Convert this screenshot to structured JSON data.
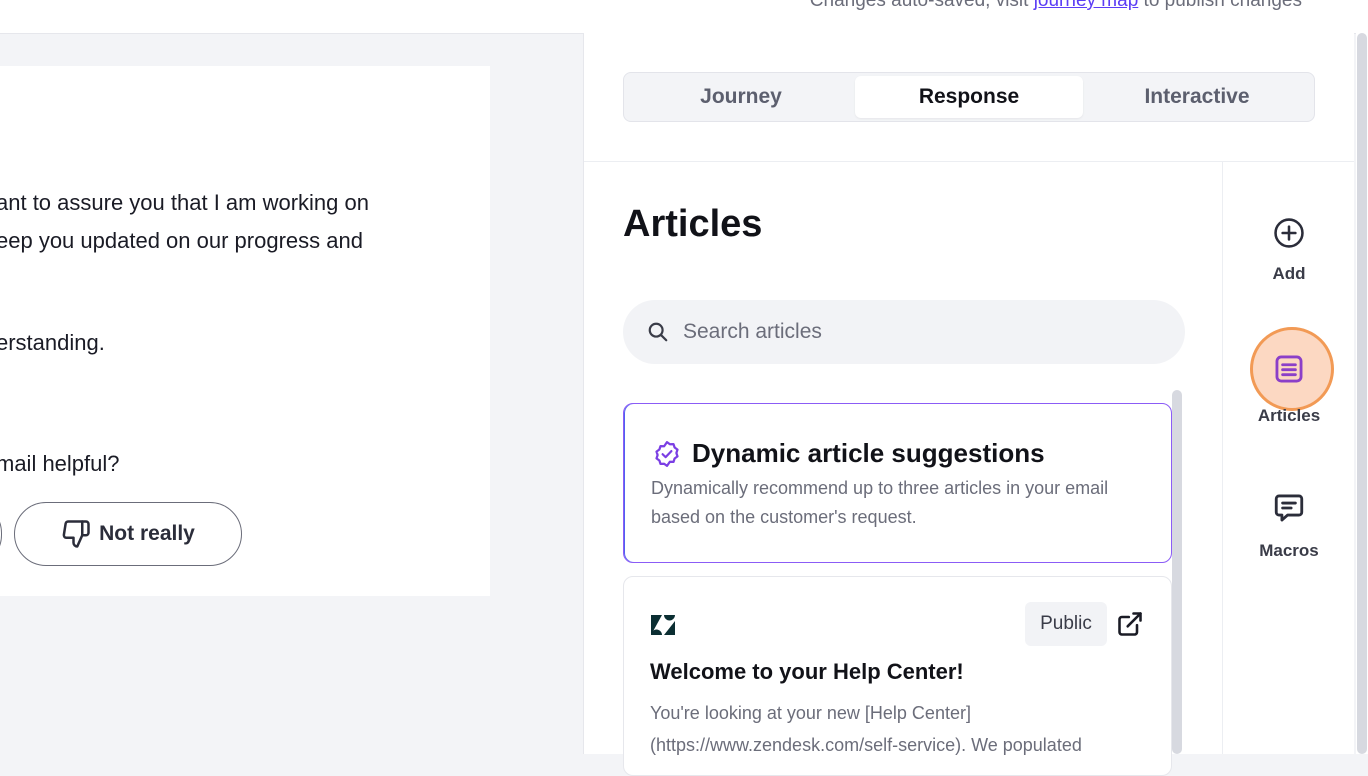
{
  "topbar": {
    "notice_prefix": "Changes auto-saved, visit ",
    "notice_link": "journey map",
    "notice_suffix": " to publish changes"
  },
  "email": {
    "para1_line1": "ant to assure you that I am working on",
    "para1_line2": "eep you updated on our progress and",
    "para2": "erstanding.",
    "question": "mail helpful?",
    "feedback_no": "Not really"
  },
  "tabs": [
    {
      "label": "Journey"
    },
    {
      "label": "Response"
    },
    {
      "label": "Interactive"
    }
  ],
  "active_tab": "Response",
  "articles": {
    "title": "Articles",
    "search_placeholder": "Search articles",
    "dynamic": {
      "title": "Dynamic article suggestions",
      "description": "Dynamically recommend up to three articles in your email based on the customer's request."
    },
    "items": [
      {
        "visibility": "Public",
        "title": "Welcome to your Help Center!",
        "excerpt": "You're looking at your new [Help Center] (https://www.zendesk.com/self-service). We populated"
      }
    ]
  },
  "rail": [
    {
      "label": "Add",
      "icon": "plus-circle-icon"
    },
    {
      "label": "Articles",
      "icon": "article-icon"
    },
    {
      "label": "Macros",
      "icon": "macro-icon"
    }
  ],
  "colors": {
    "accent": "#5b3df5",
    "highlight": "#f29a55",
    "rail_articles": "#8b3fc8"
  }
}
